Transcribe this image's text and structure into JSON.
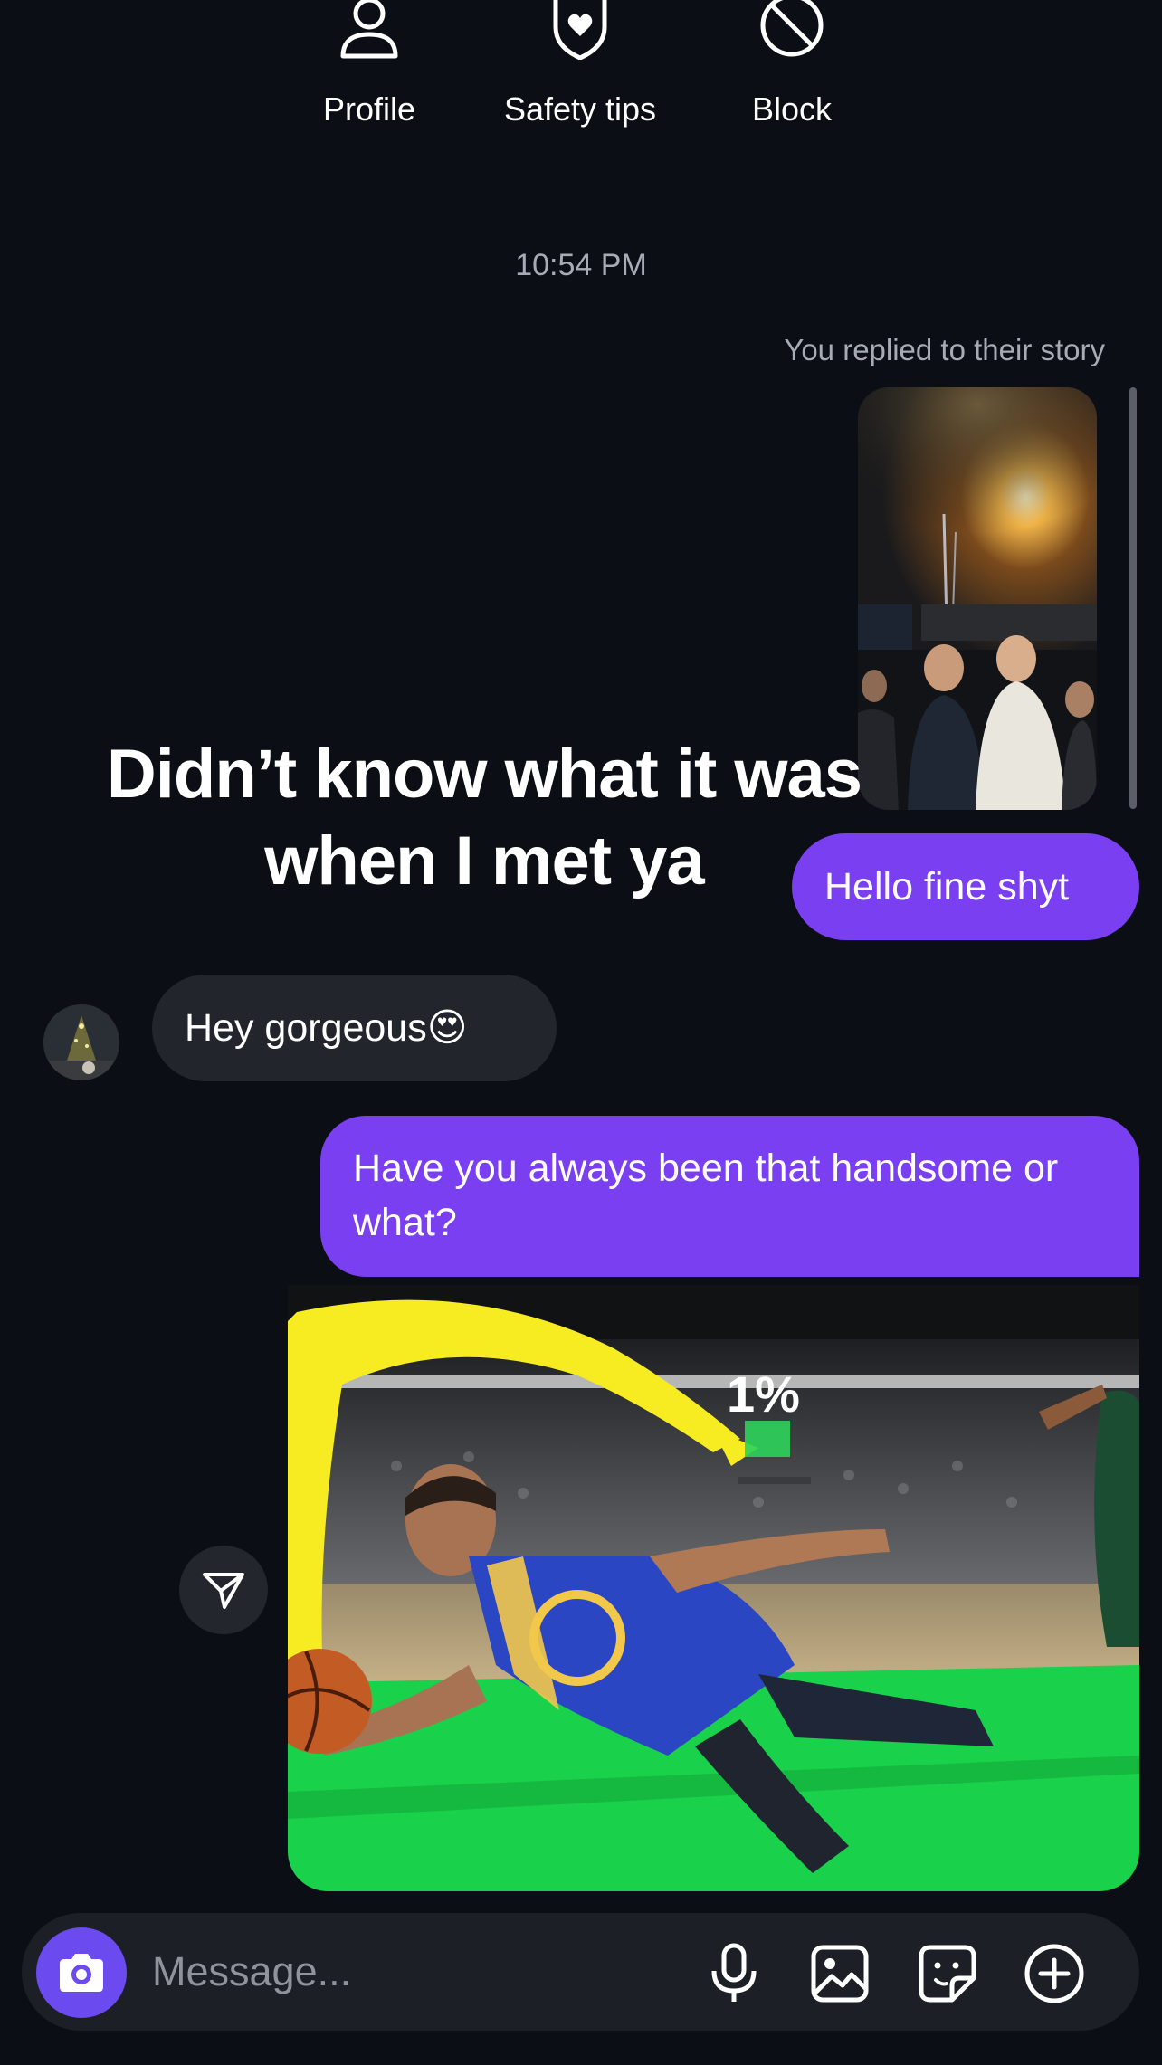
{
  "top_actions": [
    {
      "label": "Profile",
      "icon": "person-icon"
    },
    {
      "label": "Safety tips",
      "icon": "shield-heart-icon"
    },
    {
      "label": "Block",
      "icon": "block-icon"
    }
  ],
  "chat": {
    "timestamp": "10:54 PM",
    "story_reply_note": "You replied to their story",
    "story_caption_line1": "Didn’t know what it was",
    "story_caption_line2": "when I met ya",
    "messages": [
      {
        "from": "me",
        "text": "Hello fine shyt"
      },
      {
        "from": "them",
        "text": "Hey gorgeous",
        "emoji": "😍"
      },
      {
        "from": "me",
        "text": "Have you always been that handsome or what?"
      }
    ],
    "image_overlay_text": "1%"
  },
  "composer": {
    "placeholder": "Message...",
    "value": ""
  },
  "colors": {
    "background": "#0b0e14",
    "outgoing_bubble": "#7b3ff2",
    "incoming_bubble": "#22252c",
    "camera_button": "#6b4af0"
  }
}
